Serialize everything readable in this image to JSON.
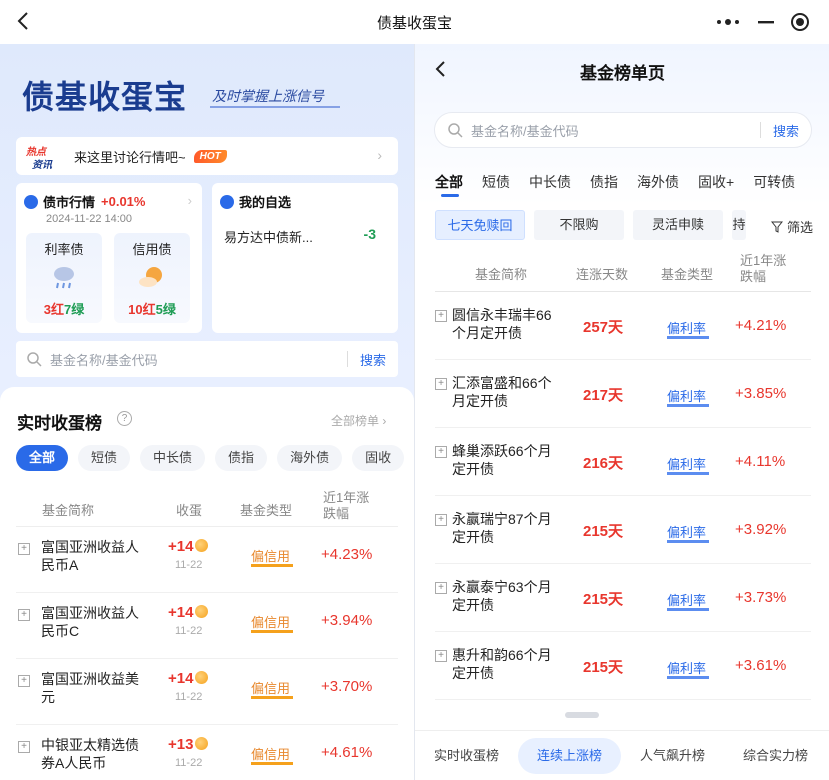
{
  "window": {
    "title": "债基收蛋宝"
  },
  "brand": {
    "name": "债基收蛋宝",
    "slogan": "及时掌握上涨信号"
  },
  "hot": {
    "tag_top": "热点",
    "tag_bottom": "资讯",
    "text": "来这里讨论行情吧~",
    "badge": "HOT"
  },
  "market": {
    "title": "债市行情",
    "change": "+0.01%",
    "date": "2024-11-22 14:00",
    "items": [
      {
        "label": "利率债",
        "red": "3红",
        "green": "7绿",
        "weather": "rain-cloud-icon"
      },
      {
        "label": "信用债",
        "red": "10红",
        "green": "5绿",
        "weather": "sun-cloud-icon"
      }
    ]
  },
  "favorites": {
    "title": "我的自选",
    "item": "易方达中债新...",
    "value": "-3"
  },
  "left_search": {
    "placeholder": "基金名称/基金代码",
    "button": "搜索"
  },
  "realtime": {
    "title": "实时收蛋榜",
    "all_link": "全部榜单 ›",
    "tabs": [
      "全部",
      "短债",
      "中长债",
      "债指",
      "海外债",
      "固收"
    ],
    "headers": {
      "name": "基金简称",
      "egg": "收蛋",
      "type": "基金类型",
      "change": "近1年涨跌幅"
    },
    "rows": [
      {
        "name": "富国亚洲收益人民币A",
        "egg": "+14",
        "date": "11-22",
        "type": "偏信用",
        "change": "+4.23%"
      },
      {
        "name": "富国亚洲收益人民币C",
        "egg": "+14",
        "date": "11-22",
        "type": "偏信用",
        "change": "+3.94%"
      },
      {
        "name": "富国亚洲收益美元",
        "egg": "+14",
        "date": "11-22",
        "type": "偏信用",
        "change": "+3.70%"
      },
      {
        "name": "中银亚太精选债券A人民币",
        "egg": "+13",
        "date": "11-22",
        "type": "偏信用",
        "change": "+4.61%"
      }
    ]
  },
  "rank": {
    "title": "基金榜单页",
    "search": {
      "placeholder": "基金名称/基金代码",
      "button": "搜索"
    },
    "categories": [
      "全部",
      "短债",
      "中长债",
      "债指",
      "海外债",
      "固收+",
      "可转债"
    ],
    "filters": [
      "七天免赎回",
      "不限购",
      "灵活申赎",
      "持"
    ],
    "screen": "筛选",
    "headers": {
      "name": "基金简称",
      "days": "连涨天数",
      "type": "基金类型",
      "change": "近1年涨跌幅"
    },
    "rows": [
      {
        "name": "圆信永丰瑞丰66个月定开债",
        "days": "257天",
        "type": "偏利率",
        "change": "+4.21%"
      },
      {
        "name": "汇添富盛和66个月定开债",
        "days": "217天",
        "type": "偏利率",
        "change": "+3.85%"
      },
      {
        "name": "蜂巢添跃66个月定开债",
        "days": "216天",
        "type": "偏利率",
        "change": "+4.11%"
      },
      {
        "name": "永赢瑞宁87个月定开债",
        "days": "215天",
        "type": "偏利率",
        "change": "+3.92%"
      },
      {
        "name": "永赢泰宁63个月定开债",
        "days": "215天",
        "type": "偏利率",
        "change": "+3.73%"
      },
      {
        "name": "惠升和韵66个月定开债",
        "days": "215天",
        "type": "偏利率",
        "change": "+3.61%"
      }
    ],
    "bottom_tabs": [
      "实时收蛋榜",
      "连续上涨榜",
      "人气飙升榜",
      "综合实力榜"
    ]
  },
  "colors": {
    "accent": "#2a6ae8",
    "up": "#e8362d",
    "down": "#1f9d55",
    "credit": "#e8882d"
  }
}
